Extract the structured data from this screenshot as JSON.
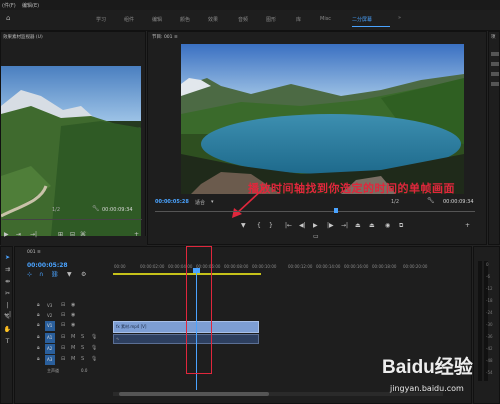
{
  "menubar": {
    "items": [
      "(件(F)",
      "编辑(E)"
    ]
  },
  "workspace": {
    "tabs": [
      "学习",
      "组件",
      "编辑",
      "颜色",
      "效果",
      "音频",
      "图形",
      "库",
      "Misc",
      "二分屏幕"
    ],
    "active": "二分屏幕"
  },
  "source_panel": {
    "title": "效果素材监视器 (U)",
    "zoom": "1/2",
    "timecode": "00:00:09:34"
  },
  "program_panel": {
    "title": "节目: 001 ≡",
    "timecode_in": "00:00:05:28",
    "fit": "适合",
    "quality": "1/2",
    "duration": "00:00:09:34"
  },
  "annotation": {
    "text": "播放时间轴找到你选定的时间的单帧画面"
  },
  "timeline": {
    "tab": "001 ≡",
    "timecode": "00:00:05:28",
    "ruler": [
      "00:00",
      "00:00:02:00",
      "00:00:04:00",
      "00:00:06:00",
      "00:00:08:00",
      "00:00:10:00",
      "00:00:12:00",
      "00:00:14:00",
      "00:00:16:00",
      "00:00:18:00",
      "00:00:20:00"
    ],
    "video_tracks": [
      "V3",
      "V2",
      "V1"
    ],
    "audio_tracks": [
      "A1",
      "A2",
      "A3"
    ],
    "master": "主声道",
    "master_value": "0.0",
    "clip_label": "fx 素材.mp4 [V]"
  },
  "right_panel": {
    "title": "项"
  },
  "meter": {
    "labels": [
      "0",
      "-6",
      "-12",
      "-18",
      "-24",
      "-30",
      "-36",
      "-42",
      "-48",
      "-54"
    ]
  },
  "watermark": {
    "text": "Baidu经验",
    "url": "jingyan.baidu.com"
  },
  "colors": {
    "accent": "#4aa3ff",
    "annotation": "#e0273c",
    "playhead": "#4aa3ff",
    "clip": "#7d9ed4"
  }
}
